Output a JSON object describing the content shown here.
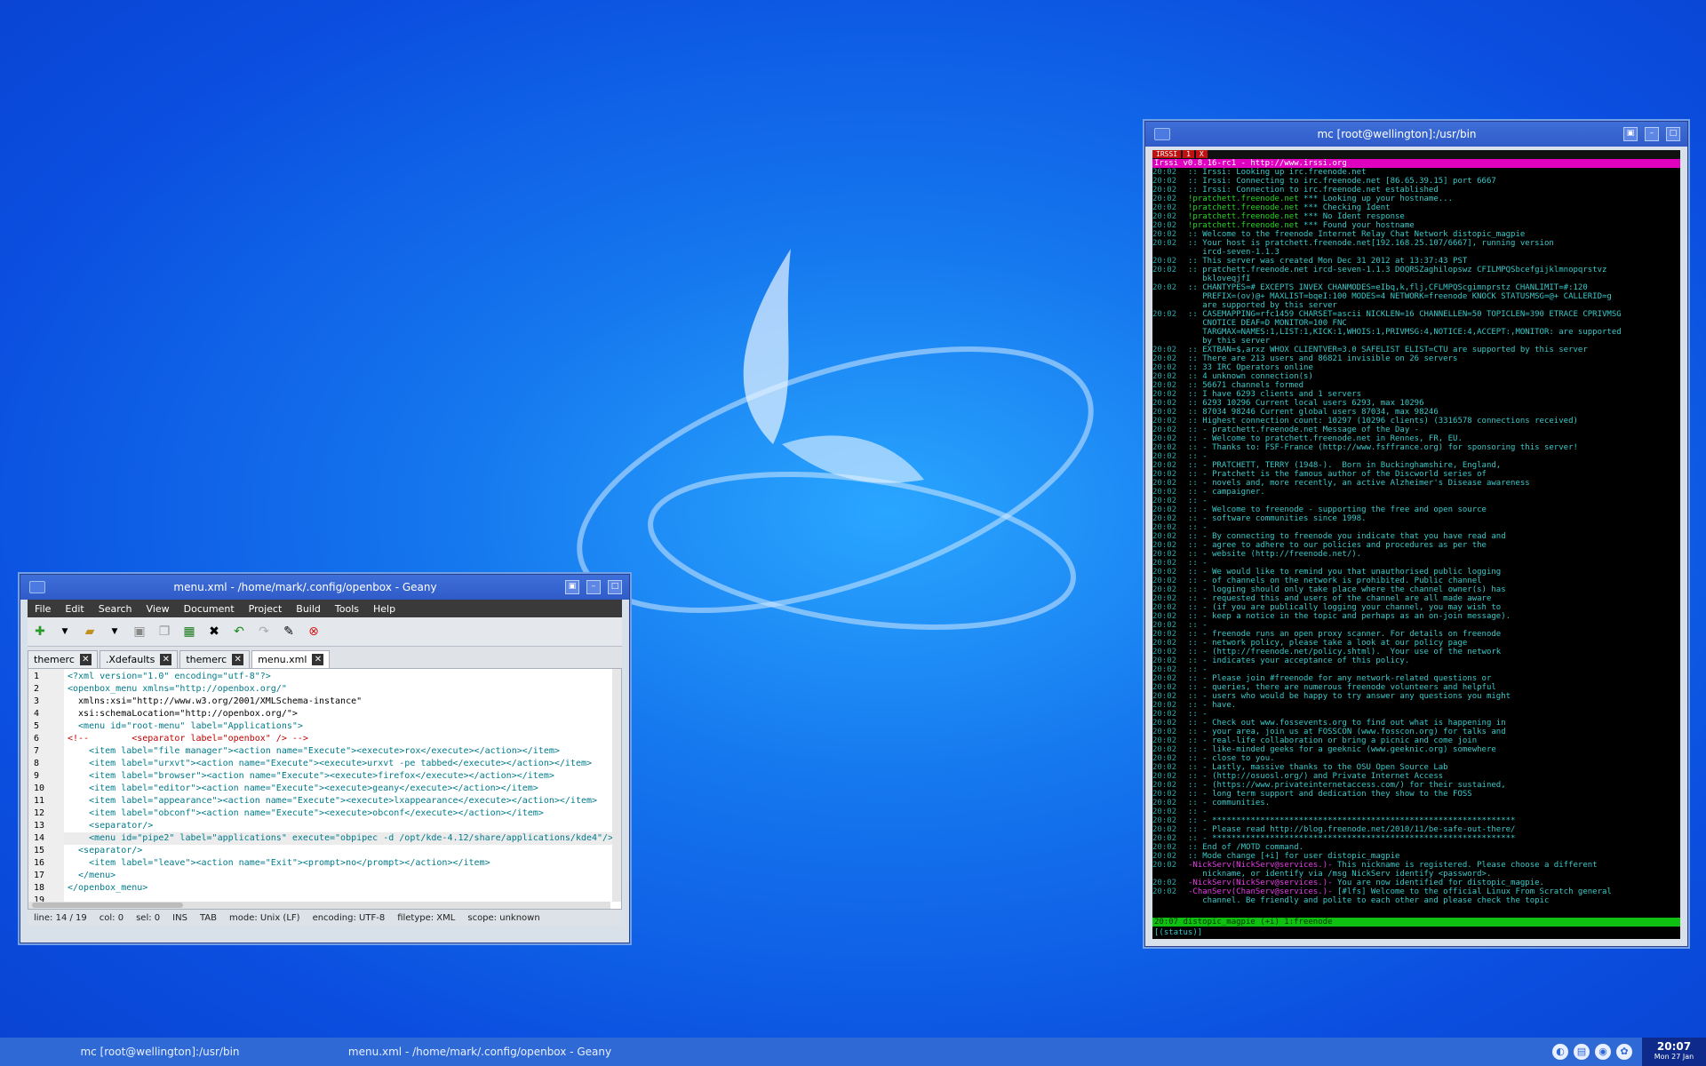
{
  "geany": {
    "title": "menu.xml - /home/mark/.config/openbox - Geany",
    "menu": [
      "File",
      "Edit",
      "Search",
      "View",
      "Document",
      "Project",
      "Build",
      "Tools",
      "Help"
    ],
    "tabs": [
      {
        "label": "themerc"
      },
      {
        "label": ".Xdefaults"
      },
      {
        "label": "themerc"
      },
      {
        "label": "menu.xml",
        "active": true
      }
    ],
    "line_numbers": [
      "1",
      "2",
      "3",
      "4",
      "5",
      "6",
      "7",
      "8",
      "9",
      "10",
      "11",
      "12",
      "13",
      "14",
      "15",
      "16",
      "17",
      "18",
      "19"
    ],
    "code_lines": [
      "<?xml version=\"1.0\" encoding=\"utf-8\"?>",
      "<openbox_menu xmlns=\"http://openbox.org/\"",
      "  xmlns:xsi=\"http://www.w3.org/2001/XMLSchema-instance\"",
      "  xsi:schemaLocation=\"http://openbox.org/\">",
      "  <menu id=\"root-menu\" label=\"Applications\">",
      "<!--        <separator label=\"openbox\" /> -->",
      "    <item label=\"file manager\"><action name=\"Execute\"><execute>rox</execute></action></item>",
      "    <item label=\"urxvt\"><action name=\"Execute\"><execute>urxvt -pe tabbed</execute></action></item>",
      "    <item label=\"browser\"><action name=\"Execute\"><execute>firefox</execute></action></item>",
      "    <item label=\"editor\"><action name=\"Execute\"><execute>geany</execute></action></item>",
      "    <item label=\"appearance\"><action name=\"Execute\"><execute>lxappearance</execute></action></item>",
      "    <item label=\"obconf\"><action name=\"Execute\"><execute>obconf</execute></action></item>",
      "    <separator/>",
      "    <menu id=\"pipe2\" label=\"applications\" execute=\"obpipec -d /opt/kde-4.12/share/applications/kde4\"/>",
      "  <separator/>",
      "    <item label=\"leave\"><action name=\"Exit\"><prompt>no</prompt></action></item>",
      "  </menu>",
      "</openbox_menu>",
      ""
    ],
    "status": {
      "line": "line: 14 / 19",
      "col": "col: 0",
      "sel": "sel: 0",
      "ins": "INS",
      "tab": "TAB",
      "mode": "mode: Unix (LF)",
      "encoding": "encoding: UTF-8",
      "filetype": "filetype: XML",
      "scope": "scope: unknown"
    }
  },
  "terminal": {
    "title": "mc [root@wellington]:/usr/bin",
    "topbar": [
      "IRSSI",
      "1",
      "X"
    ],
    "irssi_title": "Irssi v0.8.16-rc1 - http://www.irssi.org",
    "lines": [
      {
        "ts": "20:02",
        "p": "::",
        "msg": " Irssi: Looking up irc.freenode.net"
      },
      {
        "ts": "20:02",
        "p": "::",
        "msg": " Irssi: Connecting to irc.freenode.net [86.65.39.15] port 6667"
      },
      {
        "ts": "20:02",
        "p": "::",
        "msg": " Irssi: Connection to irc.freenode.net established"
      },
      {
        "ts": "20:02",
        "p": "!pratchett.freenode.net",
        "msg": " *** Looking up your hostname..."
      },
      {
        "ts": "20:02",
        "p": "!pratchett.freenode.net",
        "msg": " *** Checking Ident"
      },
      {
        "ts": "20:02",
        "p": "!pratchett.freenode.net",
        "msg": " *** No Ident response"
      },
      {
        "ts": "20:02",
        "p": "!pratchett.freenode.net",
        "msg": " *** Found your hostname"
      },
      {
        "ts": "20:02",
        "p": "::",
        "msg": " Welcome to the freenode Internet Relay Chat Network distopic_magpie"
      },
      {
        "ts": "20:02",
        "p": "::",
        "msg": " Your host is pratchett.freenode.net[192.168.25.107/6667], running version"
      },
      {
        "ts": "",
        "p": "  ",
        "msg": " ircd-seven-1.1.3"
      },
      {
        "ts": "20:02",
        "p": "::",
        "msg": " This server was created Mon Dec 31 2012 at 13:37:43 PST"
      },
      {
        "ts": "20:02",
        "p": "::",
        "msg": " pratchett.freenode.net ircd-seven-1.1.3 DOQRSZaghilopswz CFILMPQSbcefgijklmnopqrstvz"
      },
      {
        "ts": "",
        "p": "  ",
        "msg": " bkloveqjfI"
      },
      {
        "ts": "20:02",
        "p": "::",
        "msg": " CHANTYPES=# EXCEPTS INVEX CHANMODES=eIbq,k,flj,CFLMPQScgimnprstz CHANLIMIT=#:120"
      },
      {
        "ts": "",
        "p": "  ",
        "msg": " PREFIX=(ov)@+ MAXLIST=bqeI:100 MODES=4 NETWORK=freenode KNOCK STATUSMSG=@+ CALLERID=g"
      },
      {
        "ts": "",
        "p": "  ",
        "msg": " are supported by this server"
      },
      {
        "ts": "20:02",
        "p": "::",
        "msg": " CASEMAPPING=rfc1459 CHARSET=ascii NICKLEN=16 CHANNELLEN=50 TOPICLEN=390 ETRACE CPRIVMSG"
      },
      {
        "ts": "",
        "p": "  ",
        "msg": " CNOTICE DEAF=D MONITOR=100 FNC"
      },
      {
        "ts": "",
        "p": "  ",
        "msg": " TARGMAX=NAMES:1,LIST:1,KICK:1,WHOIS:1,PRIVMSG:4,NOTICE:4,ACCEPT:,MONITOR: are supported"
      },
      {
        "ts": "",
        "p": "  ",
        "msg": " by this server"
      },
      {
        "ts": "20:02",
        "p": "::",
        "msg": " EXTBAN=$,arxz WHOX CLIENTVER=3.0 SAFELIST ELIST=CTU are supported by this server"
      },
      {
        "ts": "20:02",
        "p": "::",
        "msg": " There are 213 users and 86821 invisible on 26 servers"
      },
      {
        "ts": "20:02",
        "p": "::",
        "msg": " 33 IRC Operators online"
      },
      {
        "ts": "20:02",
        "p": "::",
        "msg": " 4 unknown connection(s)"
      },
      {
        "ts": "20:02",
        "p": "::",
        "msg": " 56671 channels formed"
      },
      {
        "ts": "20:02",
        "p": "::",
        "msg": " I have 6293 clients and 1 servers"
      },
      {
        "ts": "20:02",
        "p": "::",
        "msg": " 6293 10296 Current local users 6293, max 10296"
      },
      {
        "ts": "20:02",
        "p": "::",
        "msg": " 87034 98246 Current global users 87034, max 98246"
      },
      {
        "ts": "20:02",
        "p": "::",
        "msg": " Highest connection count: 10297 (10296 clients) (3316578 connections received)"
      },
      {
        "ts": "20:02",
        "p": "::",
        "msg": " - pratchett.freenode.net Message of the Day -"
      },
      {
        "ts": "20:02",
        "p": "::",
        "msg": " - Welcome to pratchett.freenode.net in Rennes, FR, EU."
      },
      {
        "ts": "20:02",
        "p": "::",
        "msg": " - Thanks to: FSF-France (http://www.fsffrance.org) for sponsoring this server!"
      },
      {
        "ts": "20:02",
        "p": "::",
        "msg": " -"
      },
      {
        "ts": "20:02",
        "p": "::",
        "msg": " - PRATCHETT, TERRY (1948-).  Born in Buckinghamshire, England,"
      },
      {
        "ts": "20:02",
        "p": "::",
        "msg": " - Pratchett is the famous author of the Discworld series of"
      },
      {
        "ts": "20:02",
        "p": "::",
        "msg": " - novels and, more recently, an active Alzheimer's Disease awareness"
      },
      {
        "ts": "20:02",
        "p": "::",
        "msg": " - campaigner."
      },
      {
        "ts": "20:02",
        "p": "::",
        "msg": " -"
      },
      {
        "ts": "20:02",
        "p": "::",
        "msg": " - Welcome to freenode - supporting the free and open source"
      },
      {
        "ts": "20:02",
        "p": "::",
        "msg": " - software communities since 1998."
      },
      {
        "ts": "20:02",
        "p": "::",
        "msg": " -"
      },
      {
        "ts": "20:02",
        "p": "::",
        "msg": " - By connecting to freenode you indicate that you have read and"
      },
      {
        "ts": "20:02",
        "p": "::",
        "msg": " - agree to adhere to our policies and procedures as per the"
      },
      {
        "ts": "20:02",
        "p": "::",
        "msg": " - website (http://freenode.net/)."
      },
      {
        "ts": "20:02",
        "p": "::",
        "msg": " -"
      },
      {
        "ts": "20:02",
        "p": "::",
        "msg": " - We would like to remind you that unauthorised public logging"
      },
      {
        "ts": "20:02",
        "p": "::",
        "msg": " - of channels on the network is prohibited. Public channel"
      },
      {
        "ts": "20:02",
        "p": "::",
        "msg": " - logging should only take place where the channel owner(s) has"
      },
      {
        "ts": "20:02",
        "p": "::",
        "msg": " - requested this and users of the channel are all made aware"
      },
      {
        "ts": "20:02",
        "p": "::",
        "msg": " - (if you are publically logging your channel, you may wish to"
      },
      {
        "ts": "20:02",
        "p": "::",
        "msg": " - keep a notice in the topic and perhaps as an on-join message)."
      },
      {
        "ts": "20:02",
        "p": "::",
        "msg": " -"
      },
      {
        "ts": "20:02",
        "p": "::",
        "msg": " - freenode runs an open proxy scanner. For details on freenode"
      },
      {
        "ts": "20:02",
        "p": "::",
        "msg": " - network policy, please take a look at our policy page"
      },
      {
        "ts": "20:02",
        "p": "::",
        "msg": " - (http://freenode.net/policy.shtml).  Your use of the network"
      },
      {
        "ts": "20:02",
        "p": "::",
        "msg": " - indicates your acceptance of this policy."
      },
      {
        "ts": "20:02",
        "p": "::",
        "msg": " -"
      },
      {
        "ts": "20:02",
        "p": "::",
        "msg": " - Please join #freenode for any network-related questions or"
      },
      {
        "ts": "20:02",
        "p": "::",
        "msg": " - queries, there are numerous freenode volunteers and helpful"
      },
      {
        "ts": "20:02",
        "p": "::",
        "msg": " - users who would be happy to try answer any questions you might"
      },
      {
        "ts": "20:02",
        "p": "::",
        "msg": " - have."
      },
      {
        "ts": "20:02",
        "p": "::",
        "msg": " -"
      },
      {
        "ts": "20:02",
        "p": "::",
        "msg": " - Check out www.fossevents.org to find out what is happening in"
      },
      {
        "ts": "20:02",
        "p": "::",
        "msg": " - your area, join us at FOSSCON (www.fosscon.org) for talks and"
      },
      {
        "ts": "20:02",
        "p": "::",
        "msg": " - real-life collaboration or bring a picnic and come join"
      },
      {
        "ts": "20:02",
        "p": "::",
        "msg": " - like-minded geeks for a geeknic (www.geeknic.org) somewhere"
      },
      {
        "ts": "20:02",
        "p": "::",
        "msg": " - close to you."
      },
      {
        "ts": "20:02",
        "p": "::",
        "msg": " - Lastly, massive thanks to the OSU Open Source Lab"
      },
      {
        "ts": "20:02",
        "p": "::",
        "msg": " - (http://osuosl.org/) and Private Internet Access"
      },
      {
        "ts": "20:02",
        "p": "::",
        "msg": " - (https://www.privateinternetaccess.com/) for their sustained,"
      },
      {
        "ts": "20:02",
        "p": "::",
        "msg": " - long term support and dedication they show to the FOSS"
      },
      {
        "ts": "20:02",
        "p": "::",
        "msg": " - communities."
      },
      {
        "ts": "20:02",
        "p": "::",
        "msg": " -"
      },
      {
        "ts": "20:02",
        "p": "::",
        "msg": " - ***************************************************************"
      },
      {
        "ts": "20:02",
        "p": "::",
        "msg": " - Please read http://blog.freenode.net/2010/11/be-safe-out-there/"
      },
      {
        "ts": "20:02",
        "p": "::",
        "msg": " - ***************************************************************"
      },
      {
        "ts": "20:02",
        "p": "::",
        "msg": " End of /MOTD command."
      },
      {
        "ts": "20:02",
        "p": "::",
        "msg": " Mode change [+i] for user distopic_magpie"
      },
      {
        "ts": "20:02",
        "p": "-NickServ(NickServ@services.)-",
        "msg": " This nickname is registered. Please choose a different"
      },
      {
        "ts": "",
        "p": "  ",
        "msg": " nickname, or identify via /msg NickServ identify <password>."
      },
      {
        "ts": "20:02",
        "p": "-NickServ(NickServ@services.)-",
        "msg": " You are now identified for distopic_magpie."
      },
      {
        "ts": "20:02",
        "p": "-ChanServ(ChanServ@services.)-",
        "msg": " [#lfs] Welcome to the official Linux From Scratch general"
      },
      {
        "ts": "",
        "p": "  ",
        "msg": " channel. Be friendly and polite to each other and please check the topic"
      }
    ],
    "statusbar": "20:07 distopic_magpie (+i) 1:freenode",
    "prompt": "[(status)] "
  },
  "taskbar": {
    "tasks": [
      "mc [root@wellington]:/usr/bin",
      "menu.xml - /home/mark/.config/openbox - Geany"
    ],
    "tray_icons": [
      "steam-icon",
      "network-icon",
      "volume-icon",
      "settings-icon"
    ],
    "time": "20:07",
    "date": "Mon 27 Jan"
  }
}
